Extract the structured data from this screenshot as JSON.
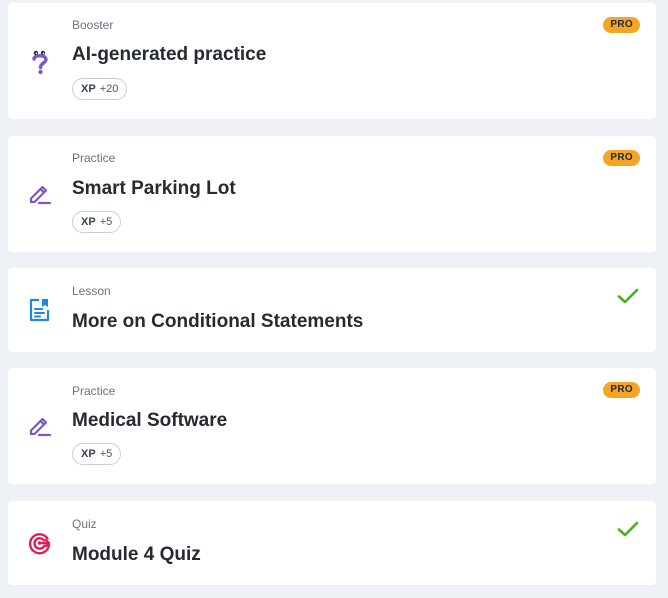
{
  "items": [
    {
      "type": "Booster",
      "title": "AI-generated practice",
      "xp_label": "XP",
      "xp_value": "+20",
      "badge": "PRO",
      "icon": "question-mark-icon",
      "status": "pro"
    },
    {
      "type": "Practice",
      "title": "Smart Parking Lot",
      "xp_label": "XP",
      "xp_value": "+5",
      "badge": "PRO",
      "icon": "pencil-icon",
      "status": "pro"
    },
    {
      "type": "Lesson",
      "title": "More on Conditional Statements",
      "icon": "lesson-document-icon",
      "status": "completed"
    },
    {
      "type": "Practice",
      "title": "Medical Software",
      "xp_label": "XP",
      "xp_value": "+5",
      "badge": "PRO",
      "icon": "pencil-icon",
      "status": "pro"
    },
    {
      "type": "Quiz",
      "title": "Module 4 Quiz",
      "icon": "target-icon",
      "status": "completed"
    }
  ],
  "colors": {
    "background": "#eef1f5",
    "card": "#ffffff",
    "pro_badge": "#f5a524",
    "check": "#4caf21",
    "practice_icon": "#7e57c2",
    "lesson_icon": "#1e88e5",
    "quiz_icon": "#e01e5a"
  }
}
